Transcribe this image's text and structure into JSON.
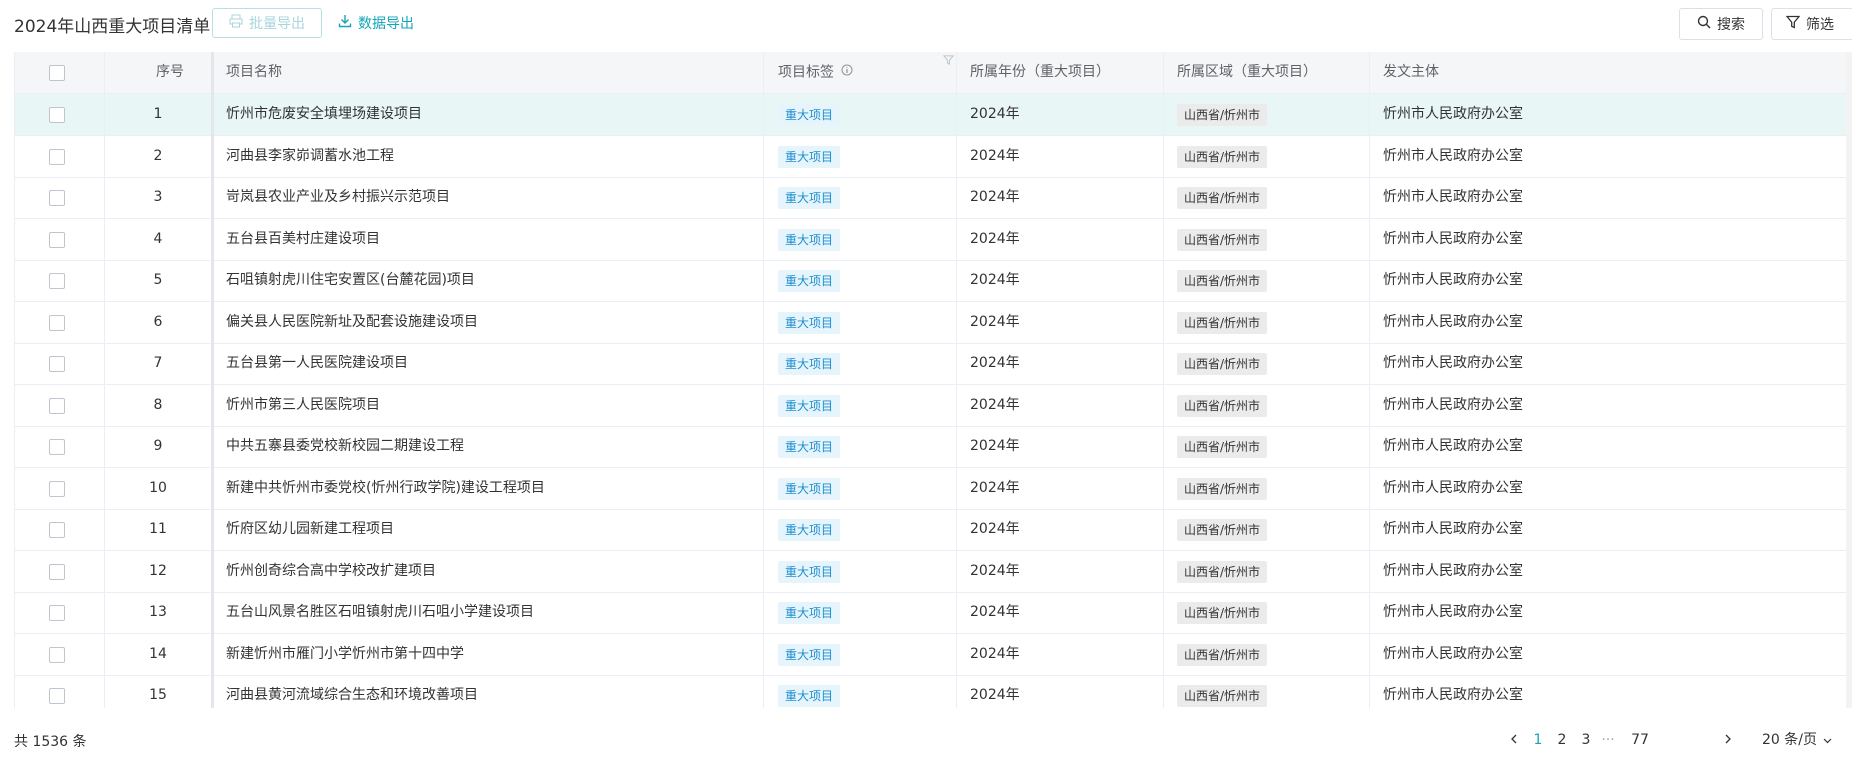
{
  "page": {
    "title": "2024年山西重大项目清单",
    "bulk_export_label": "批量导出",
    "data_export_label": "数据导出",
    "search_label": "搜索",
    "filter_label": "筛选"
  },
  "table": {
    "headers": {
      "index": "序号",
      "name": "项目名称",
      "tag": "项目标签",
      "year": "所属年份（重大项目）",
      "region": "所属区域（重大项目）",
      "issuer": "发文主体"
    },
    "rows": [
      {
        "index": "1",
        "name": "忻州市危废安全填埋场建设项目",
        "tag": "重大项目",
        "year": "2024年",
        "region": "山西省/忻州市",
        "issuer": "忻州市人民政府办公室"
      },
      {
        "index": "2",
        "name": "河曲县李家峁调蓄水池工程",
        "tag": "重大项目",
        "year": "2024年",
        "region": "山西省/忻州市",
        "issuer": "忻州市人民政府办公室"
      },
      {
        "index": "3",
        "name": "岢岚县农业产业及乡村振兴示范项目",
        "tag": "重大项目",
        "year": "2024年",
        "region": "山西省/忻州市",
        "issuer": "忻州市人民政府办公室"
      },
      {
        "index": "4",
        "name": "五台县百美村庄建设项目",
        "tag": "重大项目",
        "year": "2024年",
        "region": "山西省/忻州市",
        "issuer": "忻州市人民政府办公室"
      },
      {
        "index": "5",
        "name": "石咀镇射虎川住宅安置区(台麓花园)项目",
        "tag": "重大项目",
        "year": "2024年",
        "region": "山西省/忻州市",
        "issuer": "忻州市人民政府办公室"
      },
      {
        "index": "6",
        "name": "偏关县人民医院新址及配套设施建设项目",
        "tag": "重大项目",
        "year": "2024年",
        "region": "山西省/忻州市",
        "issuer": "忻州市人民政府办公室"
      },
      {
        "index": "7",
        "name": "五台县第一人民医院建设项目",
        "tag": "重大项目",
        "year": "2024年",
        "region": "山西省/忻州市",
        "issuer": "忻州市人民政府办公室"
      },
      {
        "index": "8",
        "name": "忻州市第三人民医院项目",
        "tag": "重大项目",
        "year": "2024年",
        "region": "山西省/忻州市",
        "issuer": "忻州市人民政府办公室"
      },
      {
        "index": "9",
        "name": "中共五寨县委党校新校园二期建设工程",
        "tag": "重大项目",
        "year": "2024年",
        "region": "山西省/忻州市",
        "issuer": "忻州市人民政府办公室"
      },
      {
        "index": "10",
        "name": "新建中共忻州市委党校(忻州行政学院)建设工程项目",
        "tag": "重大项目",
        "year": "2024年",
        "region": "山西省/忻州市",
        "issuer": "忻州市人民政府办公室"
      },
      {
        "index": "11",
        "name": "忻府区幼儿园新建工程项目",
        "tag": "重大项目",
        "year": "2024年",
        "region": "山西省/忻州市",
        "issuer": "忻州市人民政府办公室"
      },
      {
        "index": "12",
        "name": "忻州创奇综合高中学校改扩建项目",
        "tag": "重大项目",
        "year": "2024年",
        "region": "山西省/忻州市",
        "issuer": "忻州市人民政府办公室"
      },
      {
        "index": "13",
        "name": "五台山风景名胜区石咀镇射虎川石咀小学建设项目",
        "tag": "重大项目",
        "year": "2024年",
        "region": "山西省/忻州市",
        "issuer": "忻州市人民政府办公室"
      },
      {
        "index": "14",
        "name": "新建忻州市雁门小学忻州市第十四中学",
        "tag": "重大项目",
        "year": "2024年",
        "region": "山西省/忻州市",
        "issuer": "忻州市人民政府办公室"
      },
      {
        "index": "15",
        "name": "河曲县黄河流域综合生态和环境改善项目",
        "tag": "重大项目",
        "year": "2024年",
        "region": "山西省/忻州市",
        "issuer": "忻州市人民政府办公室"
      }
    ]
  },
  "footer": {
    "total_text": "共 1536 条",
    "pages": [
      "1",
      "2",
      "3",
      "···",
      "77"
    ],
    "current_page": "1",
    "page_size": "20 条/页"
  },
  "colors": {
    "accent": "#14a6b8",
    "tag_blue_bg": "#e6f4fb",
    "tag_blue_text": "#1d8fd2",
    "row_highlight": "#e8f6f6"
  }
}
